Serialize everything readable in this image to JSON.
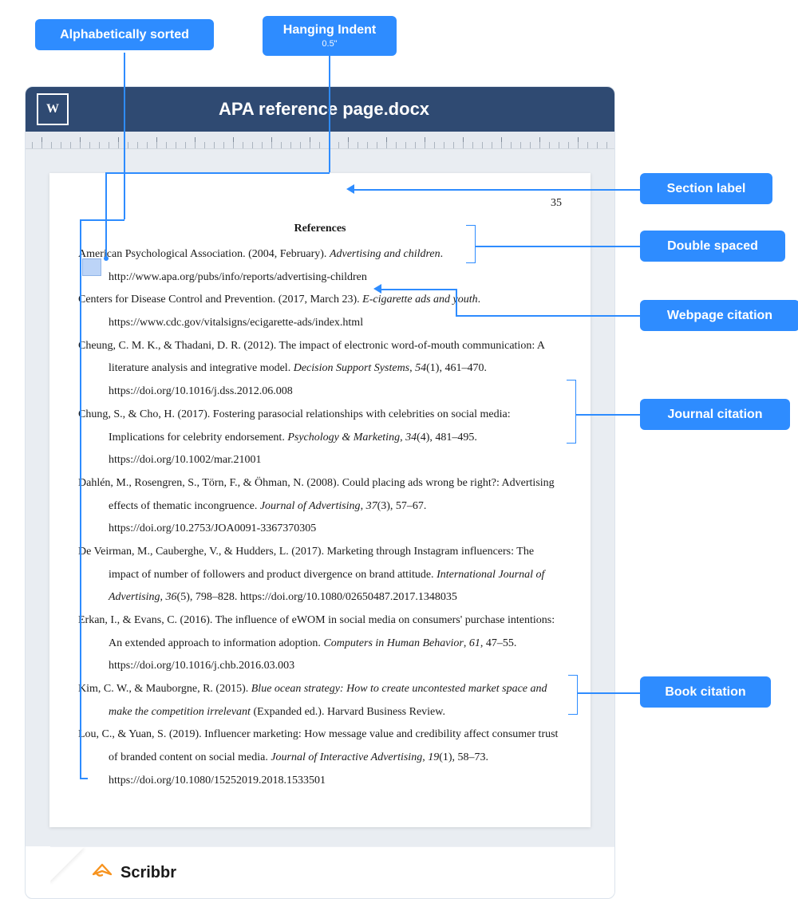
{
  "tags": {
    "alphabetical": "Alphabetically sorted",
    "hanging": "Hanging Indent",
    "hanging_sub": "0.5\"",
    "section": "Section label",
    "double": "Double spaced",
    "webpage": "Webpage citation",
    "journal": "Journal citation",
    "book": "Book citation"
  },
  "doc": {
    "title": "APA reference page.docx",
    "word_mark": "W",
    "page_number": "35",
    "heading": "References"
  },
  "references": [
    {
      "pre": "American Psychological Association. (2004, February). ",
      "ital": "Advertising and children",
      "post": ". http://www.apa.org/pubs/info/reports/advertising-children"
    },
    {
      "pre": "Centers for Disease Control and Prevention. (2017, March 23). ",
      "ital": "E-cigarette ads and youth",
      "post": ". https://www.cdc.gov/vitalsigns/ecigarette-ads/index.html"
    },
    {
      "pre": "Cheung, C. M. K., & Thadani, D. R. (2012). The impact of electronic word-of-mouth communication: A literature analysis and integrative model. ",
      "ital": "Decision Support Systems",
      "post": ", ",
      "ital2": "54",
      "post2": "(1), 461–470. https://doi.org/10.1016/j.dss.2012.06.008"
    },
    {
      "pre": "Chung, S., & Cho, H. (2017). Fostering parasocial relationships with celebrities on social media: Implications for celebrity endorsement. ",
      "ital": "Psychology & Marketing",
      "post": ", ",
      "ital2": "34",
      "post2": "(4), 481–495. https://doi.org/10.1002/mar.21001"
    },
    {
      "pre": "Dahlén, M., Rosengren, S., Törn, F., & Öhman, N. (2008). Could placing ads wrong be right?: Advertising effects of thematic incongruence. ",
      "ital": "Journal of Advertising",
      "post": ", ",
      "ital2": "37",
      "post2": "(3), 57–67. https://doi.org/10.2753/JOA0091-3367370305"
    },
    {
      "pre": "De Veirman, M., Cauberghe, V., & Hudders, L. (2017). Marketing through Instagram influencers: The impact of number of followers and product divergence on brand attitude. ",
      "ital": "International Journal of Advertising",
      "post": ", ",
      "ital2": "36",
      "post2": "(5), 798–828. https://doi.org/10.1080/02650487.2017.1348035"
    },
    {
      "pre": "Erkan, I., & Evans, C. (2016). The influence of eWOM in social media on consumers' purchase intentions: An extended approach to information adoption. ",
      "ital": "Computers in Human Behavior",
      "post": ", ",
      "ital2": "61",
      "post2": ", 47–55. https://doi.org/10.1016/j.chb.2016.03.003"
    },
    {
      "pre": "Kim, C. W., & Mauborgne, R. (2015). ",
      "ital": "Blue ocean strategy: How to create uncontested market space and make the competition irrelevant",
      "post": " (Expanded ed.). Harvard Business Review."
    },
    {
      "pre": "Lou, C., & Yuan, S. (2019). Influencer marketing: How message value and credibility affect consumer trust of branded content on social media. ",
      "ital": "Journal of Interactive Advertising",
      "post": ", ",
      "ital2": "19",
      "post2": "(1), 58–73. https://doi.org/10.1080/15252019.2018.1533501"
    }
  ],
  "footer": {
    "brand": "Scribbr"
  }
}
